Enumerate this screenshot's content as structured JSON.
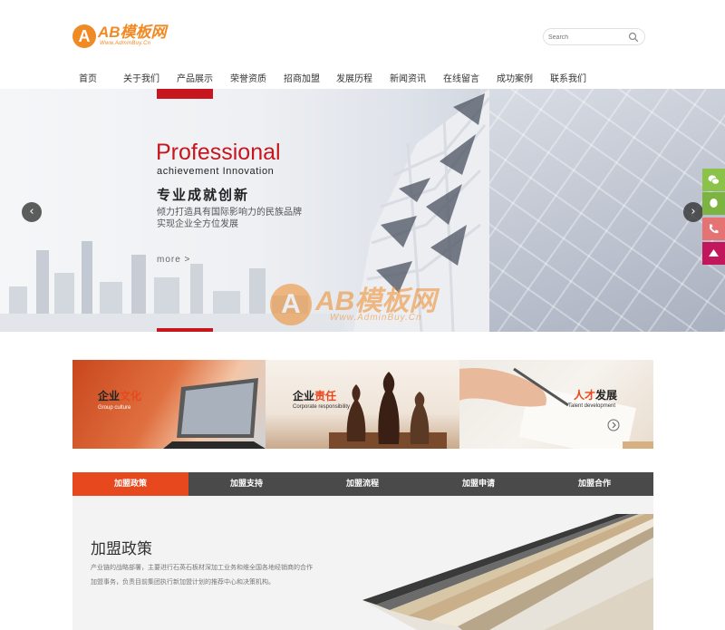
{
  "header": {
    "logo": {
      "mark": "A",
      "text": "AB模板网",
      "sub": "Www.AdminBuy.Cn"
    },
    "search": {
      "placeholder": "Search"
    }
  },
  "nav": {
    "items": [
      {
        "label": "首页"
      },
      {
        "label": "关于我们"
      },
      {
        "label": "产品展示"
      },
      {
        "label": "荣誉资质"
      },
      {
        "label": "招商加盟"
      },
      {
        "label": "发展历程"
      },
      {
        "label": "新闻资讯"
      },
      {
        "label": "在线留言"
      },
      {
        "label": "成功案例"
      },
      {
        "label": "联系我们"
      }
    ]
  },
  "banner": {
    "title": "Professional",
    "subtitle": "achievement Innovation",
    "cn_title": "专业成就创新",
    "line1": "倾力打造具有国际影响力的民族品牌",
    "line2": "实现企业全方位发展",
    "more": "more  >",
    "prev": "‹",
    "next": "›",
    "watermark": {
      "mark": "A",
      "text": "AB模板网",
      "sub": "Www.AdminBuy.Cn"
    },
    "colors": {
      "accent": "#c7161e"
    }
  },
  "side_tools": [
    {
      "icon": "wechat-icon",
      "color": "#8bc34a"
    },
    {
      "icon": "qq-icon",
      "color": "#7cb342"
    },
    {
      "icon": "phone-icon",
      "color": "#e57373"
    },
    {
      "icon": "top-icon",
      "color": "#c2185b"
    }
  ],
  "cards": [
    {
      "title_a": "企业",
      "title_b": "文化",
      "sub": "Group culture"
    },
    {
      "title_a": "企业",
      "title_b": "责任",
      "sub": "Corporate responsibility"
    },
    {
      "title_a": "人才",
      "title_b": "发展",
      "sub": "Talent development"
    }
  ],
  "tabs": [
    {
      "label": "加盟政策"
    },
    {
      "label": "加盟支持"
    },
    {
      "label": "加盟流程"
    },
    {
      "label": "加盟申请"
    },
    {
      "label": "加盟合作"
    }
  ],
  "content": {
    "title": "加盟政策",
    "line1": "产业链的战略部署，主要进行石英石板材深加工业务和维全国各地经销商的合作",
    "line2": "加盟事务，负责目前集团执行新加盟计划的推荐中心和决策机构。"
  },
  "colors": {
    "brand": "#f08a24",
    "tab_active": "#e8481d",
    "tab_bar": "#4a4a4a"
  }
}
